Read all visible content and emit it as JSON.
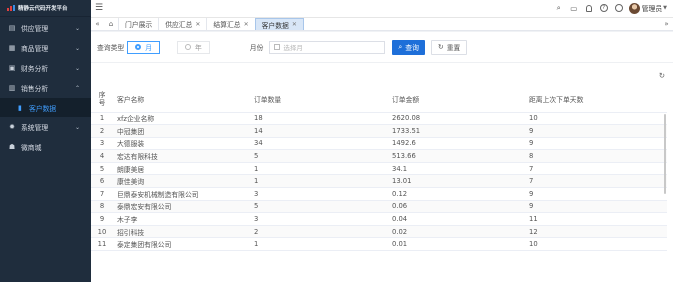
{
  "app": {
    "title": "精静云代码开发平台"
  },
  "sidebar": {
    "items": [
      {
        "label": "供应管理",
        "icon": "truck-icon"
      },
      {
        "label": "商品管理",
        "icon": "grid-icon"
      },
      {
        "label": "财务分析",
        "icon": "finance-icon"
      },
      {
        "label": "销售分析",
        "icon": "chart-icon"
      },
      {
        "label": "客户数据",
        "icon": "bar-chart-icon"
      },
      {
        "label": "系统管理",
        "icon": "gear-icon"
      },
      {
        "label": "微商城",
        "icon": "shop-icon"
      }
    ]
  },
  "header": {
    "username": "管理员"
  },
  "tabs": [
    {
      "label": "门户展示"
    },
    {
      "label": "供应汇总"
    },
    {
      "label": "结算汇总"
    },
    {
      "label": "客户数据"
    }
  ],
  "filter": {
    "query_type_label": "查询类型",
    "opt_month": "月",
    "opt_year": "年",
    "month_label": "月份",
    "month_placeholder": "选择月",
    "search_btn": "查询",
    "reset_btn": "重置"
  },
  "table": {
    "headers": {
      "seq_a": "序",
      "seq_b": "号",
      "name": "客户名称",
      "count": "订单数量",
      "amount": "订单金额",
      "days": "距离上次下单天数"
    },
    "rows": [
      {
        "seq": "1",
        "name": "xfz企业名称",
        "count": "18",
        "amount": "2620.08",
        "days": "10"
      },
      {
        "seq": "2",
        "name": "中冠集团",
        "count": "14",
        "amount": "1733.51",
        "days": "9"
      },
      {
        "seq": "3",
        "name": "大德服装",
        "count": "34",
        "amount": "1492.6",
        "days": "9"
      },
      {
        "seq": "4",
        "name": "宏达有限科技",
        "count": "5",
        "amount": "513.66",
        "days": "8"
      },
      {
        "seq": "5",
        "name": "朗康美居",
        "count": "1",
        "amount": "34.1",
        "days": "7"
      },
      {
        "seq": "6",
        "name": "康佳美询",
        "count": "1",
        "amount": "13.01",
        "days": "7"
      },
      {
        "seq": "7",
        "name": "巨鼎泰安机械制造有限公司",
        "count": "3",
        "amount": "0.12",
        "days": "9"
      },
      {
        "seq": "8",
        "name": "泰鼎宏安有限公司",
        "count": "5",
        "amount": "0.06",
        "days": "9"
      },
      {
        "seq": "9",
        "name": "木子李",
        "count": "3",
        "amount": "0.04",
        "days": "11"
      },
      {
        "seq": "10",
        "name": "招引科技",
        "count": "2",
        "amount": "0.02",
        "days": "12"
      },
      {
        "seq": "11",
        "name": "泰定集团有限公司",
        "count": "1",
        "amount": "0.01",
        "days": "10"
      }
    ]
  }
}
